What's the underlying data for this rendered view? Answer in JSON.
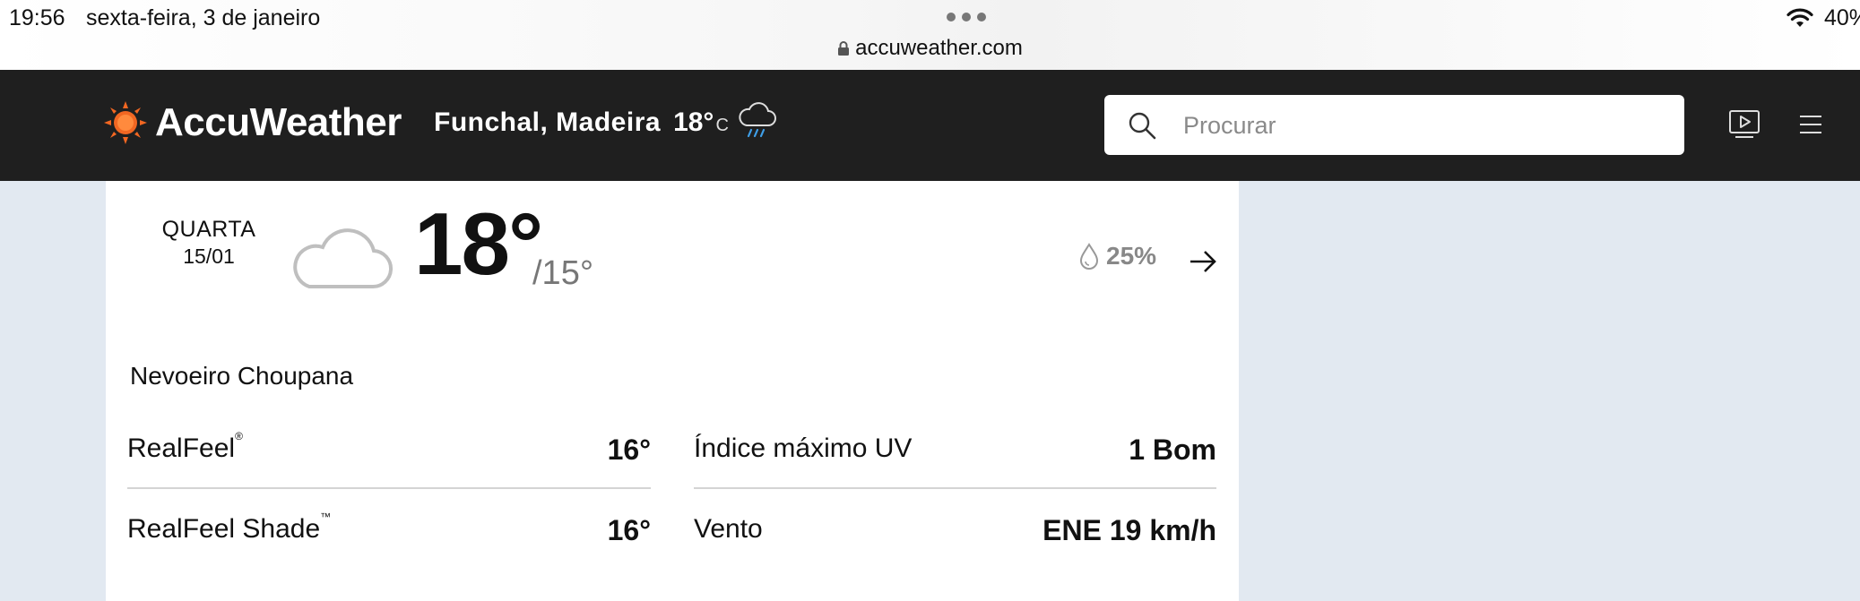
{
  "status_bar": {
    "time": "19:56",
    "date": "sexta-feira, 3 de janeiro",
    "url": "accuweather.com",
    "battery": "40%"
  },
  "header": {
    "brand": "AccuWeather",
    "location": "Funchal, Madeira",
    "current_temp": "18°",
    "unit": "C",
    "weather_icon": "cloud-rain-icon",
    "search": {
      "placeholder": "Procurar",
      "value": ""
    },
    "brand_color": "#f26722",
    "background": "#1f1f1f"
  },
  "forecast": {
    "day_name": "QUARTA",
    "day_date": "15/01",
    "condition_icon": "cloud-icon",
    "high": "18°",
    "low": "/15°",
    "precip_icon": "raindrop-icon",
    "precip": "25%",
    "phrase": "Nevoeiro Choupana",
    "details": [
      {
        "label": "RealFeel",
        "mark": "®",
        "value": "16°"
      },
      {
        "label": "Índice máximo UV",
        "value": "1 Bom"
      },
      {
        "label": "RealFeel Shade",
        "mark": "™",
        "value": "16°"
      },
      {
        "label": "Vento",
        "value": "ENE 19 km/h"
      }
    ]
  }
}
